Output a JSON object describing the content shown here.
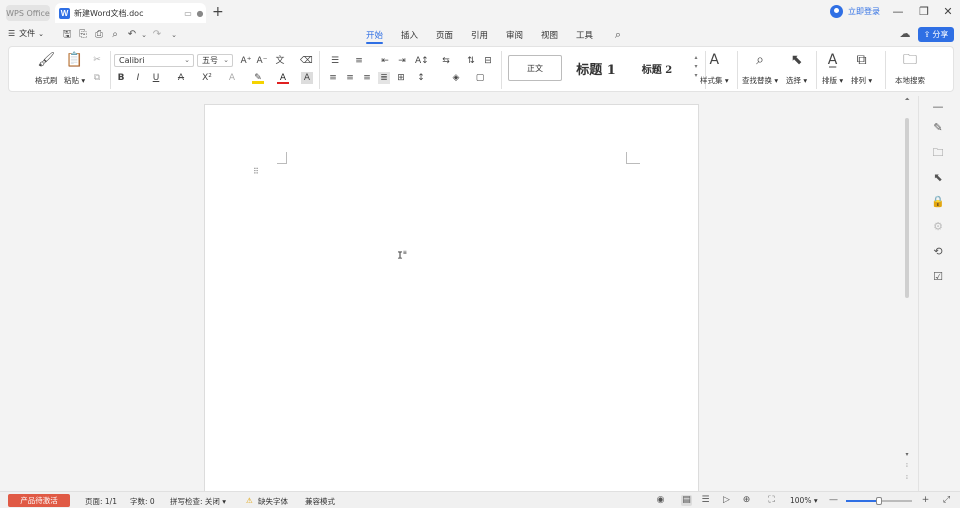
{
  "titlebar": {
    "home_tab": "WPS Office",
    "doc_tab_title": "新建Word文档.doc",
    "doc_icon_letter": "W",
    "login_label": "立即登录"
  },
  "menurow": {
    "file_label": "文件",
    "tabs": [
      "开始",
      "插入",
      "页面",
      "引用",
      "审阅",
      "视图",
      "工具"
    ],
    "active_tab": "开始",
    "share_label": "分享"
  },
  "ribbon": {
    "format_painter": "格式刷",
    "paste": "粘贴",
    "font_name": "Calibri",
    "font_size": "五号",
    "style_gallery": [
      "正文",
      "标题 1",
      "标题 2"
    ],
    "style_set": "样式集",
    "find_replace": "查找替换",
    "select": "选择",
    "layout": "排版",
    "arrange": "排列",
    "local_search": "本地搜索"
  },
  "statusbar": {
    "activate": "产品待激活",
    "page": "页面: 1/1",
    "word_count": "字数: 0",
    "spell_check": "拼写检查: 关闭",
    "missing_font": "缺失字体",
    "compat_mode": "兼容模式",
    "zoom": "100%",
    "zoom_fraction": 0.5
  },
  "colors": {
    "accent": "#2f6fe4",
    "activate_bg": "#e05a45"
  }
}
